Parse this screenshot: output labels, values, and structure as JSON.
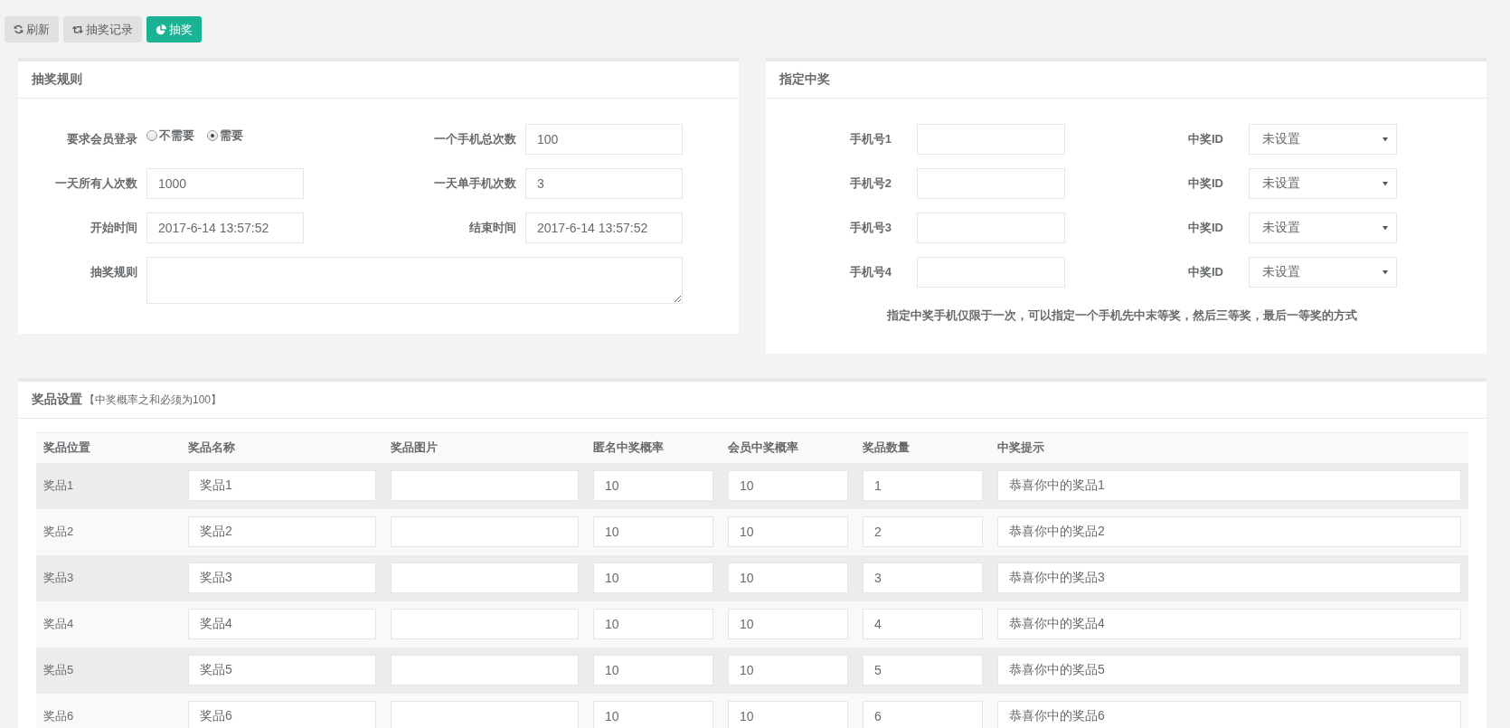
{
  "toolbar": [
    {
      "label": "刷新",
      "kind": "refresh",
      "primary": false
    },
    {
      "label": "抽奖记录",
      "kind": "history",
      "primary": false
    },
    {
      "label": "抽奖",
      "kind": "draw",
      "primary": true
    }
  ],
  "rules_panel": {
    "title": "抽奖规则",
    "fields": [
      {
        "kind": "radio",
        "label": "要求会员登录",
        "options": [
          {
            "label": "不需要",
            "selected": false
          },
          {
            "label": "需要",
            "selected": true
          }
        ]
      },
      {
        "kind": "text",
        "label": "一个手机总次数",
        "value": "100"
      },
      {
        "kind": "text",
        "label": "一天所有人次数",
        "value": "1000"
      },
      {
        "kind": "text",
        "label": "一天单手机次数",
        "value": "3"
      },
      {
        "kind": "text",
        "label": "开始时间",
        "value": "2017-6-14 13:57:52"
      },
      {
        "kind": "text",
        "label": "结束时间",
        "value": "2017-6-14 13:57:52"
      },
      {
        "kind": "textarea",
        "label": "抽奖规则"
      }
    ]
  },
  "assign_panel": {
    "title": "指定中奖",
    "rows": [
      {
        "phone_label": "手机号1",
        "prize_label": "中奖ID",
        "prize_value": "未设置"
      },
      {
        "phone_label": "手机号2",
        "prize_label": "中奖ID",
        "prize_value": "未设置"
      },
      {
        "phone_label": "手机号3",
        "prize_label": "中奖ID",
        "prize_value": "未设置"
      },
      {
        "phone_label": "手机号4",
        "prize_label": "中奖ID",
        "prize_value": "未设置"
      }
    ],
    "note": "指定中奖手机仅限于一次，可以指定一个手机先中末等奖，然后三等奖，最后一等奖的方式"
  },
  "prize_panel": {
    "title": "奖品设置",
    "hint": "【中奖概率之和必须为100】",
    "columns": [
      "奖品位置",
      "奖品名称",
      "奖品图片",
      "匿名中奖概率",
      "会员中奖概率",
      "奖品数量",
      "中奖提示"
    ],
    "rows": [
      {
        "position": "奖品1",
        "name": "奖品1",
        "anon_rate": "10",
        "member_rate": "10",
        "quantity": "1",
        "message": "恭喜你中的奖品1"
      },
      {
        "position": "奖品2",
        "name": "奖品2",
        "anon_rate": "10",
        "member_rate": "10",
        "quantity": "2",
        "message": "恭喜你中的奖品2"
      },
      {
        "position": "奖品3",
        "name": "奖品3",
        "anon_rate": "10",
        "member_rate": "10",
        "quantity": "3",
        "message": "恭喜你中的奖品3"
      },
      {
        "position": "奖品4",
        "name": "奖品4",
        "anon_rate": "10",
        "member_rate": "10",
        "quantity": "4",
        "message": "恭喜你中的奖品4"
      },
      {
        "position": "奖品5",
        "name": "奖品5",
        "anon_rate": "10",
        "member_rate": "10",
        "quantity": "5",
        "message": "恭喜你中的奖品5"
      },
      {
        "position": "奖品6",
        "name": "奖品6",
        "anon_rate": "10",
        "member_rate": "10",
        "quantity": "6",
        "message": "恭喜你中的奖品6"
      }
    ]
  }
}
